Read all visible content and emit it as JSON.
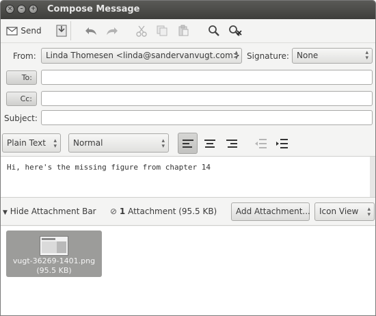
{
  "window": {
    "title": "Compose Message"
  },
  "toolbar": {
    "send_label": "Send"
  },
  "header": {
    "from_label": "From:",
    "from_value": "Linda Thomesen <linda@sandervanvugt.com>",
    "signature_label": "Signature:",
    "signature_value": "None",
    "to_button": "To:",
    "cc_button": "Cc:",
    "subject_label": "Subject:",
    "to_value": "",
    "cc_value": "",
    "subject_value": ""
  },
  "format": {
    "mode_value": "Plain Text",
    "paragraph_style_value": "Normal"
  },
  "message": {
    "body": "Hi, here's the missing figure from chapter 14"
  },
  "attachment_bar": {
    "toggle_label": "Hide Attachment Bar",
    "count": "1",
    "count_suffix": "Attachment (95.5 KB)",
    "add_button": "Add Attachment...",
    "view_value": "Icon View"
  },
  "attachments": [
    {
      "name": "vugt-36269-1401.png",
      "size": "(95.5 KB)"
    }
  ],
  "colors": {
    "titlebar": "#3e3e3c",
    "tile": "#9c9c9a"
  }
}
